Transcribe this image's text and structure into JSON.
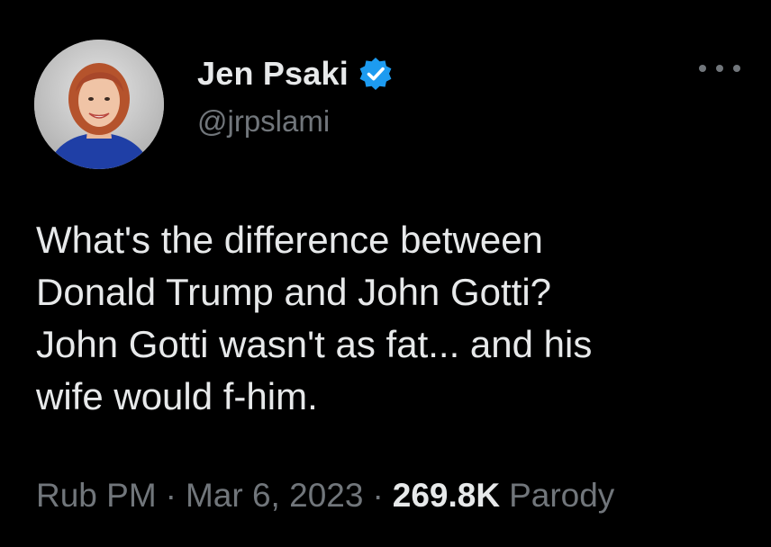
{
  "tweet": {
    "author": {
      "display_name": "Jen Psaki",
      "handle": "@jrpslami",
      "verified": true
    },
    "text": "What's the difference between\nDonald Trump and John Gotti?\nJohn Gotti wasn't as fat... and his\nwife would f-him.",
    "time": "Rub PM",
    "date": "Mar 6, 2023",
    "views": "269.8K",
    "views_label": "Parody",
    "separator": "·"
  },
  "icons": {
    "verified": "verified-badge-icon",
    "more": "more-options-icon"
  },
  "colors": {
    "background": "#000000",
    "primary_text": "#e7e9ea",
    "secondary_text": "#71767b",
    "verified_blue": "#1d9bf0"
  }
}
